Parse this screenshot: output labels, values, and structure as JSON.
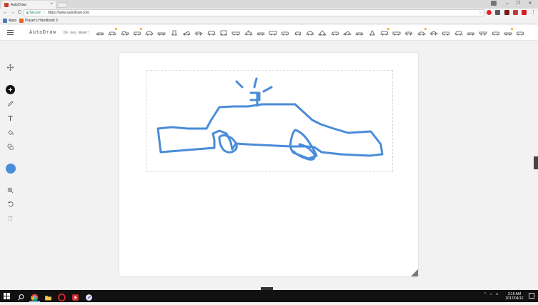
{
  "browser": {
    "tab_title": "AutoDraw",
    "tab_close": "×",
    "window_controls": {
      "minimize": "–",
      "restore": "❐",
      "close": "✕"
    },
    "address": {
      "secure_label": "Secure",
      "url": "https://www.autodraw.com"
    },
    "nav": {
      "back": "←",
      "forward": "→",
      "reload": "C",
      "star": "☆"
    }
  },
  "bookmarks": [
    {
      "label": "Apps",
      "icon": "apps-grid-icon",
      "color": "#4a78c2"
    },
    {
      "label": "Player's Handbook 5",
      "icon": "bookmark-icon",
      "color": "#e8612c"
    }
  ],
  "app": {
    "title": "AutoDraw",
    "suggestion_prompt": "Do you mean:",
    "suggestions_count_label": "",
    "accent_color": "#4a8cd8"
  },
  "tools": [
    {
      "name": "move-tool",
      "icon": "move-arrows-icon"
    },
    {
      "name": "autodraw-tool",
      "icon": "autodraw-sparkle-icon",
      "active": true
    },
    {
      "name": "draw-tool",
      "icon": "pencil-icon"
    },
    {
      "name": "type-tool",
      "icon": "text-t-icon"
    },
    {
      "name": "fill-tool",
      "icon": "paint-bucket-icon"
    },
    {
      "name": "shape-tool",
      "icon": "shapes-icon"
    },
    {
      "name": "color-picker",
      "icon": "color-swatch-icon",
      "color": "#4a8cd8"
    },
    {
      "name": "zoom-tool",
      "icon": "zoom-icon"
    },
    {
      "name": "undo-tool",
      "icon": "undo-icon"
    },
    {
      "name": "delete-tool",
      "icon": "trash-icon"
    }
  ],
  "taskbar": {
    "time": "3:16 AM",
    "date": "2017/04/12"
  }
}
